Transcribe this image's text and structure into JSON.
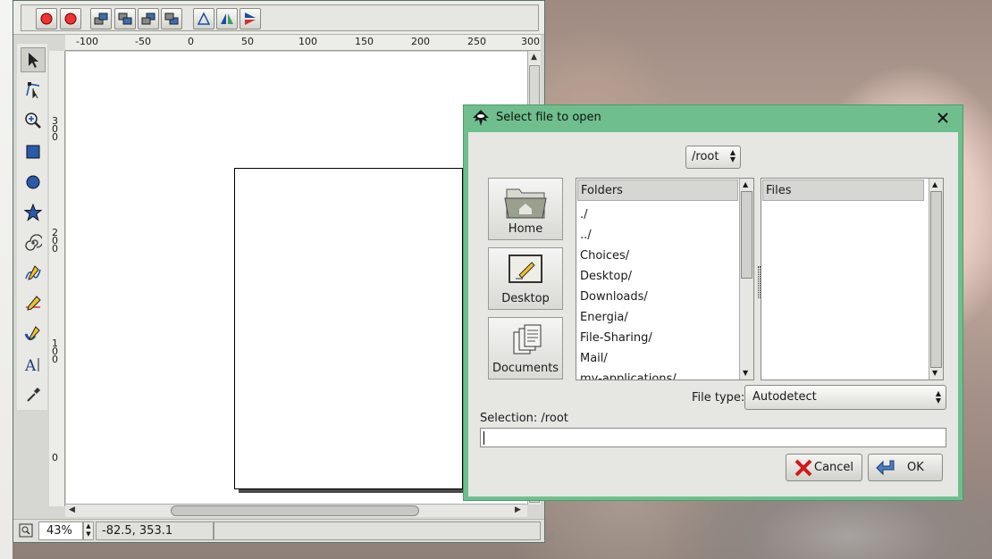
{
  "ruler": {
    "top": [
      "-100",
      "-50",
      "0",
      "50",
      "100",
      "150",
      "200",
      "250",
      "300"
    ],
    "left": [
      "300",
      "200",
      "100",
      "0"
    ]
  },
  "statusbar": {
    "zoom": "43%",
    "coords": "-82.5,  353.1"
  },
  "dialog": {
    "title": "Select file to open",
    "current_dir": "/root",
    "places": [
      {
        "label": "Home",
        "icon": "home-folder-icon"
      },
      {
        "label": "Desktop",
        "icon": "desktop-icon"
      },
      {
        "label": "Documents",
        "icon": "documents-icon"
      }
    ],
    "folders_header": "Folders",
    "folders": [
      "./",
      "../",
      "Choices/",
      "Desktop/",
      "Downloads/",
      "Energia/",
      "File-Sharing/",
      "Mail/",
      "my-applications/"
    ],
    "files_header": "Files",
    "file_type_label": "File type:",
    "file_type_value": "Autodetect",
    "selection_label": "Selection: /root",
    "selection_value": "",
    "cancel_label": "Cancel",
    "ok_label": "OK"
  },
  "colors": {
    "dialog_frame": "#6fbf8e",
    "window_bg": "#e6e6e2"
  }
}
